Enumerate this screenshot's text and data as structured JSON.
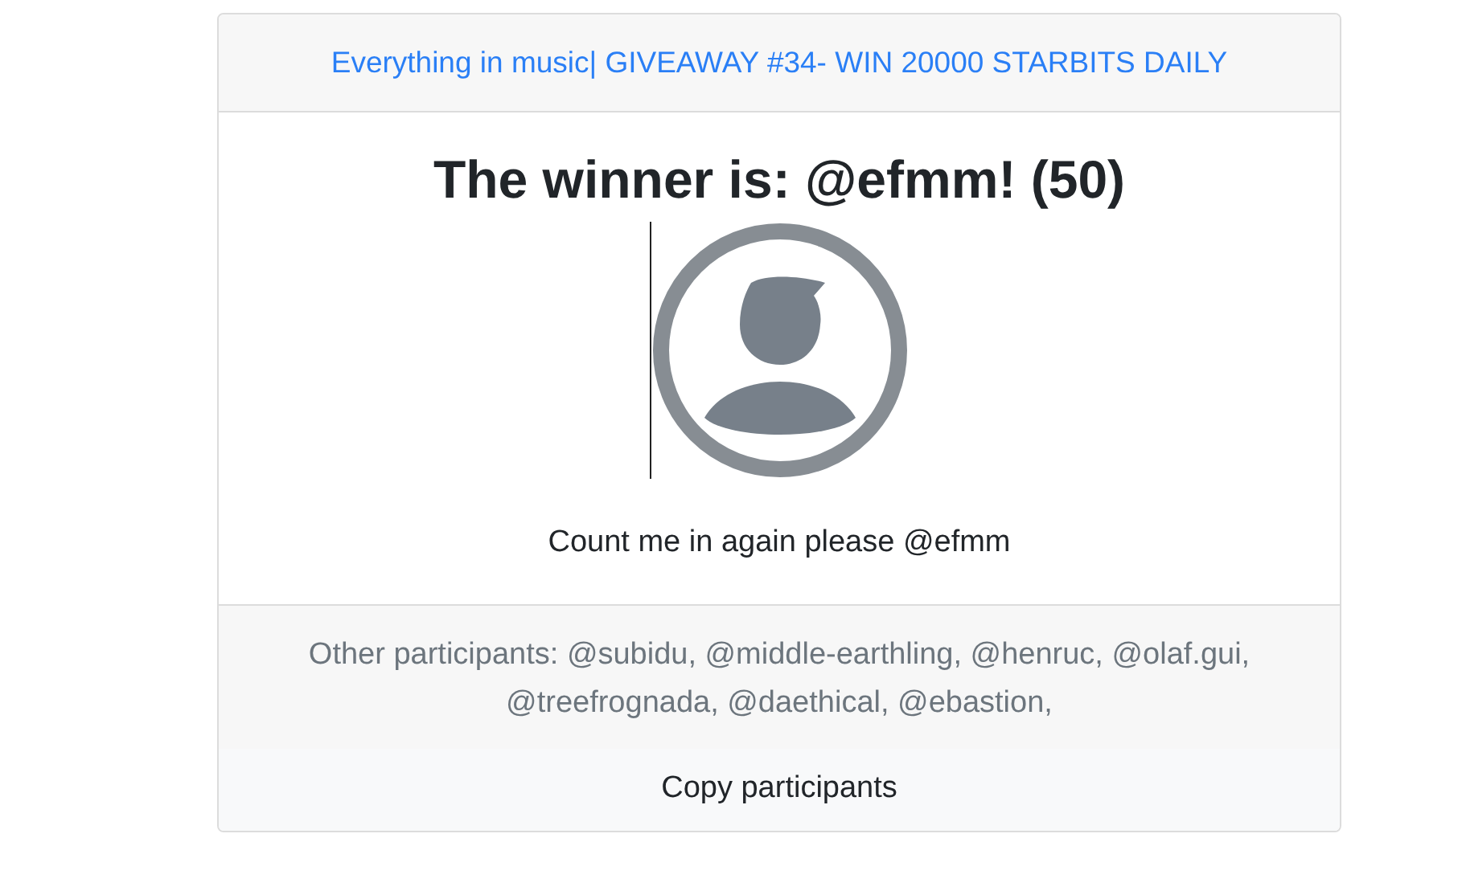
{
  "card": {
    "header_link": "Everything in music| GIVEAWAY #34- WIN 20000 STARBITS DAILY",
    "winner_title": "The winner is: @efmm! (50)",
    "comment": "Count me in again please @efmm",
    "other_participants": "Other participants: @subidu, @middle-earthling, @henruc, @olaf.gui, @treefrognada, @daethical, @ebastion,",
    "copy_button": "Copy participants"
  }
}
